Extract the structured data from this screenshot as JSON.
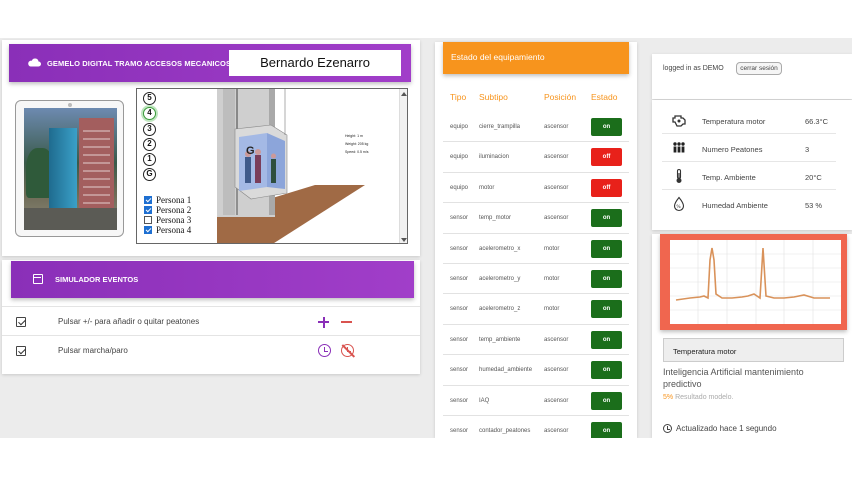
{
  "header": {
    "title": "GEMELO DIGITAL TRAMO ACCESOS MECANICOS",
    "user_name": "Bernardo Ezenarro"
  },
  "elevator": {
    "floor_buttons": [
      "5",
      "4",
      "3",
      "2",
      "1",
      "G"
    ],
    "active_floor": "4",
    "persons": [
      {
        "label": "Persona 1",
        "checked": true
      },
      {
        "label": "Persona 2",
        "checked": true
      },
      {
        "label": "Persona 3",
        "checked": false
      },
      {
        "label": "Persona 4",
        "checked": true
      }
    ],
    "specs": {
      "height_label": "Height:",
      "height_value": "1 m",
      "weight_label": "Weight:",
      "weight_value": "205 kg",
      "speed_label": "Speed:",
      "speed_value": "0.5 m/s",
      "floor_indicator": "G"
    }
  },
  "simulator": {
    "title": "SIMULADOR EVENTOS",
    "rows": [
      {
        "text": "Pulsar +/- para añadir o quitar peatones"
      },
      {
        "text": "Pulsar marcha/paro"
      }
    ]
  },
  "equipment": {
    "title": "Estado del equipamiento",
    "columns": [
      "Tipo",
      "Subtipo",
      "Posición",
      "Estado"
    ],
    "rows": [
      {
        "tipo": "equipo",
        "subtipo": "cierre_trampilla",
        "posicion": "ascensor",
        "estado": "on"
      },
      {
        "tipo": "equipo",
        "subtipo": "iluminacion",
        "posicion": "ascensor",
        "estado": "off"
      },
      {
        "tipo": "equipo",
        "subtipo": "motor",
        "posicion": "ascensor",
        "estado": "off"
      },
      {
        "tipo": "sensor",
        "subtipo": "temp_motor",
        "posicion": "ascensor",
        "estado": "on"
      },
      {
        "tipo": "sensor",
        "subtipo": "acelerometro_x",
        "posicion": "motor",
        "estado": "on"
      },
      {
        "tipo": "sensor",
        "subtipo": "acelerometro_y",
        "posicion": "motor",
        "estado": "on"
      },
      {
        "tipo": "sensor",
        "subtipo": "acelerometro_z",
        "posicion": "motor",
        "estado": "on"
      },
      {
        "tipo": "sensor",
        "subtipo": "temp_ambiente",
        "posicion": "ascensor",
        "estado": "on"
      },
      {
        "tipo": "sensor",
        "subtipo": "humedad_ambiente",
        "posicion": "ascensor",
        "estado": "on"
      },
      {
        "tipo": "sensor",
        "subtipo": "IAQ",
        "posicion": "ascensor",
        "estado": "on"
      },
      {
        "tipo": "sensor",
        "subtipo": "contador_peatones",
        "posicion": "ascensor",
        "estado": "on"
      }
    ],
    "colors": {
      "on": "#1b6e1b",
      "off": "#e8211a"
    }
  },
  "session": {
    "logged_text": "logged in as DEMO",
    "logout_label": "cerrar sesión"
  },
  "sensors": [
    {
      "label": "Temperatura motor",
      "value": "66.3°C",
      "icon": "engine-icon"
    },
    {
      "label": "Numero Peatones",
      "value": "3",
      "icon": "people-icon"
    },
    {
      "label": "Temp. Ambiente",
      "value": "20°C",
      "icon": "thermometer-icon"
    },
    {
      "label": "Humedad Ambiente",
      "value": "53 %",
      "icon": "humidity-icon"
    }
  ],
  "ai_panel": {
    "selected_signal": "Temperatura motor",
    "title": "Inteligencia Artificial mantenimiento predictivo",
    "result_pct": "5%",
    "result_text": " Resultado modelo.",
    "updated": "Actualizado hace 1 segundo"
  },
  "accent_colors": {
    "purple": "#8a2fb8",
    "orange": "#f7941d",
    "red_frame": "#f0664f",
    "trace": "#d9925a"
  }
}
